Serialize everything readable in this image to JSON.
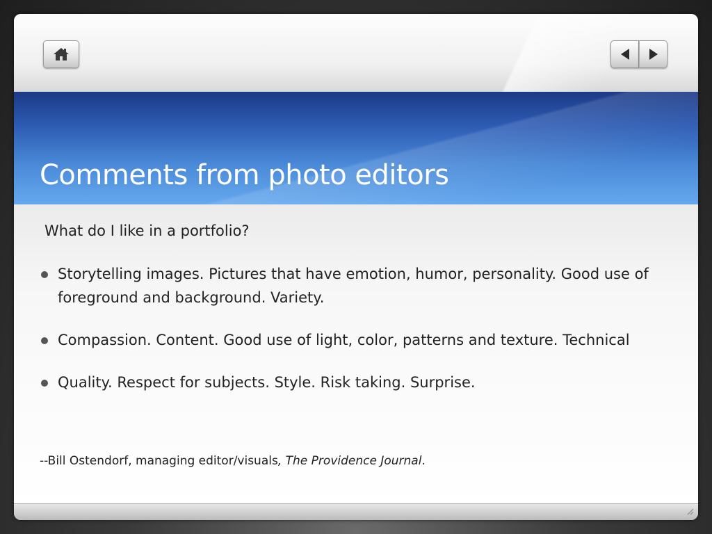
{
  "toolbar": {
    "home_icon": "home-icon",
    "prev_icon": "triangle-left-icon",
    "next_icon": "triangle-right-icon"
  },
  "slide": {
    "title": "Comments from photo editors",
    "intro": "What do I like in a portfolio?",
    "bullets": [
      "Storytelling images.  Pictures that have emotion, humor, personality. Good use of foreground and background. Variety.",
      "Compassion. Content. Good use of light, color, patterns and texture. Technical",
      "Quality. Respect for subjects. Style. Risk taking. Surprise."
    ],
    "attribution": {
      "prefix": "--Bill Ostendorf, managing editor/visuals",
      "publication": ", The Providence Journal",
      "suffix": "."
    }
  },
  "colors": {
    "title_band_top": "#1c3a86",
    "title_band_bottom": "#66a8ee",
    "title_text": "#ffffff",
    "body_text": "#222222"
  }
}
